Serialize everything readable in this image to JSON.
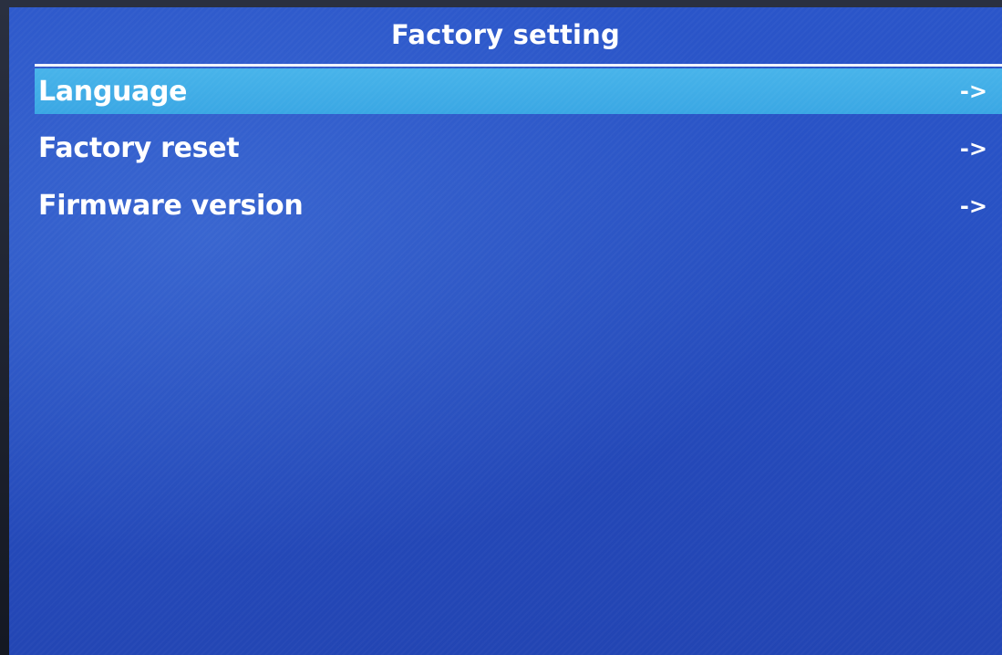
{
  "header": {
    "title": "Factory setting"
  },
  "menu": {
    "items": [
      {
        "label": "Language",
        "arrow": "->",
        "selected": true
      },
      {
        "label": "Factory reset",
        "arrow": "->",
        "selected": false
      },
      {
        "label": "Firmware version",
        "arrow": "->",
        "selected": false
      }
    ]
  },
  "colors": {
    "background": "#2750c2",
    "highlight": "#42afe7",
    "text": "#ffffff"
  }
}
